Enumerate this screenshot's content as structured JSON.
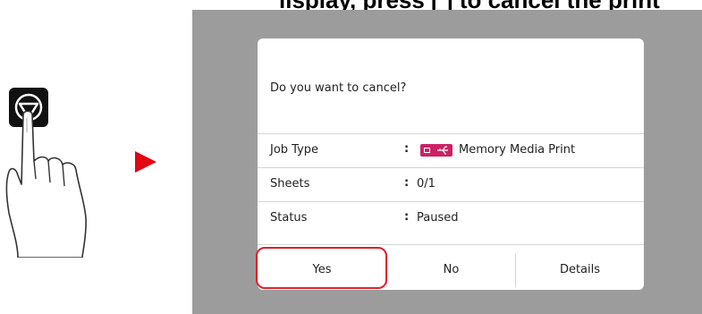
{
  "header": {
    "instruction_fragment": "lisplay, press [  ] to cancel the print"
  },
  "illustration": {
    "button_icon": "stop-icon",
    "gesture": "hand-pressing-icon",
    "arrow_icon": "play-arrow-icon",
    "arrow_color": "#e30613"
  },
  "dialog": {
    "message": "Do you want to cancel?",
    "rows": [
      {
        "label": "Job Type",
        "separator": ":",
        "value": "Memory Media Print",
        "icon": "memory-media-icon"
      },
      {
        "label": "Sheets",
        "separator": ":",
        "value": "0/1"
      },
      {
        "label": "Status",
        "separator": ":",
        "value": "Paused"
      }
    ],
    "buttons": {
      "yes": "Yes",
      "no": "No",
      "details": "Details"
    },
    "highlight_color": "#e0202a",
    "screen_background": "#9c9c9c"
  }
}
